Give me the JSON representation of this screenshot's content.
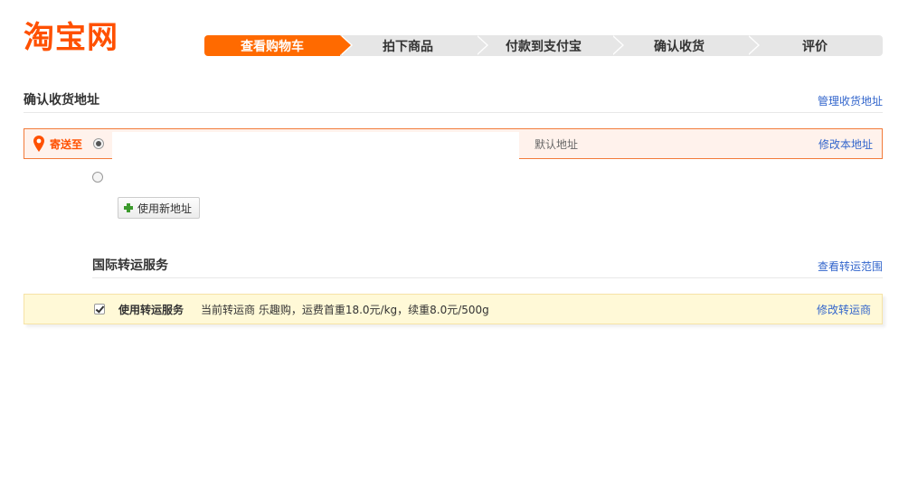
{
  "logo": {
    "text": "淘宝网",
    "color": "#ff5000"
  },
  "steps": [
    {
      "label": "查看购物车",
      "active": true
    },
    {
      "label": "拍下商品",
      "active": false
    },
    {
      "label": "付款到支付宝",
      "active": false
    },
    {
      "label": "确认收货",
      "active": false
    },
    {
      "label": "评价",
      "active": false
    }
  ],
  "address_section": {
    "title": "确认收货地址",
    "manage_link": "管理收货地址",
    "ship_to_label": "寄送至",
    "ship_to_icon": "location-pin-icon",
    "default_label": "默认地址",
    "edit_link": "修改本地址",
    "new_address_button": "使用新地址"
  },
  "transfer_section": {
    "title": "国际转运服务",
    "range_link": "查看转运范围",
    "checkbox_label": "使用转运服务",
    "info": "当前转运商 乐趣购，运费首重18.0元/kg，续重8.0元/500g",
    "edit_link": "修改转运商"
  },
  "colors": {
    "accent": "#ff6a00",
    "link": "#3366cc",
    "address_bg": "#fff2ec",
    "transfer_bg": "#fff9d7"
  }
}
